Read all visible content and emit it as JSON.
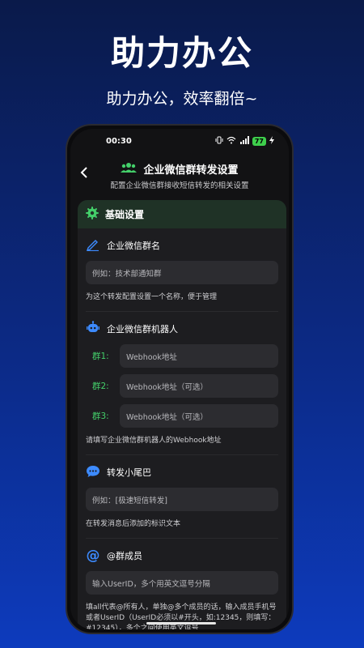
{
  "promo": {
    "title": "助力办公",
    "subtitle": "助力办公，效率翻倍~"
  },
  "status_bar": {
    "time": "00:30",
    "battery": "77"
  },
  "header": {
    "title": "企业微信群转发设置",
    "subtitle": "配置企业微信群接收短信转发的相关设置"
  },
  "card": {
    "title": "基础设置",
    "group_name": {
      "label": "企业微信群名",
      "placeholder": "例如：技术部通知群",
      "hint": "为这个转发配置设置一个名称，便于管理"
    },
    "robot": {
      "label": "企业微信群机器人",
      "rows": [
        {
          "label": "群1:",
          "placeholder": "Webhook地址"
        },
        {
          "label": "群2:",
          "placeholder": "Webhook地址（可选）"
        },
        {
          "label": "群3:",
          "placeholder": "Webhook地址（可选）"
        }
      ],
      "hint": "请填写企业微信群机器人的Webhook地址"
    },
    "tail": {
      "label": "转发小尾巴",
      "placeholder": "例如：[极速短信转发]",
      "hint": "在转发消息后添加的标识文本"
    },
    "mention": {
      "label": "@群成员",
      "placeholder": "输入UserID，多个用英文逗号分隔",
      "hint": "填all代表@所有人，单独@多个成员的话，输入成员手机号或者UserID（UserID必须以#开头，如:12345，则填写：#12345），多个之间使用英文逗号"
    }
  },
  "colors": {
    "accent_green": "#44d06a",
    "icon_blue": "#3d8bff"
  }
}
